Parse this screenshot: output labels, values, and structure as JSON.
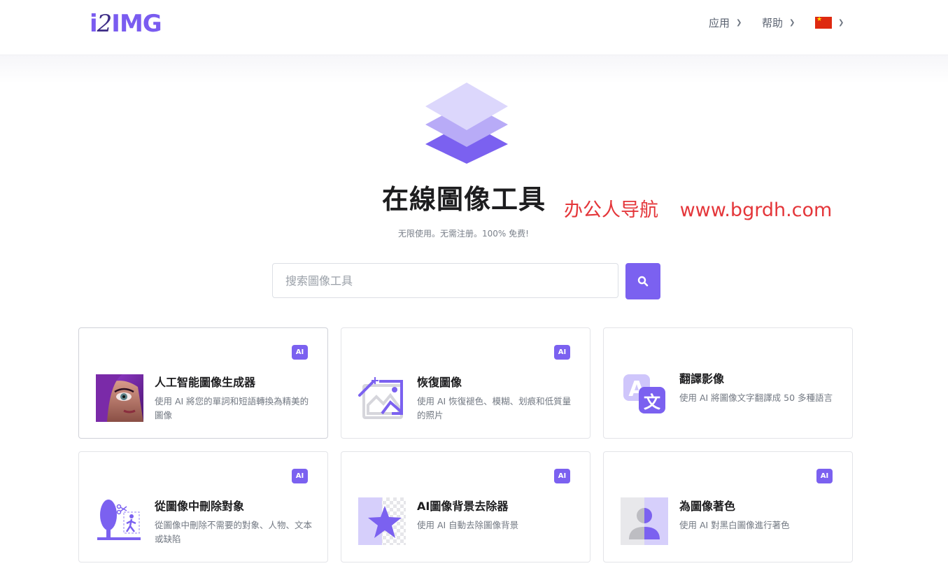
{
  "header": {
    "logo": {
      "prefix": "i",
      "two": "2",
      "suffix": "IMG"
    },
    "nav": {
      "apps": "应用",
      "help": "帮助",
      "language_flag": "china-flag-icon"
    }
  },
  "hero": {
    "title": "在線圖像工具",
    "watermark": "办公人导航 www.bgrdh.com",
    "subtitle": "无限使用。无需注册。100% 免费!"
  },
  "search": {
    "placeholder": "搜索圖像工具",
    "button_icon": "search-icon"
  },
  "tools": [
    {
      "title": "人工智能圖像生成器",
      "desc": "使用 AI 將您的單詞和短語轉換為精美的圖像",
      "badge": "AI",
      "icon": "ai-portrait-image"
    },
    {
      "title": "恢復圖像",
      "desc": "使用 AI 恢復褪色、模糊、划痕和低質量的照片",
      "badge": "AI",
      "icon": "magic-wand-image-icon"
    },
    {
      "title": "翻譯影像",
      "desc": "使用 AI 將圖像文字翻譯成 50 多種語言",
      "badge": "",
      "icon": "translate-icon"
    },
    {
      "title": "從圖像中刪除對象",
      "desc": "從圖像中刪除不需要的對象、人物、文本或缺陷",
      "badge": "AI",
      "icon": "object-remove-icon"
    },
    {
      "title": "AI圖像背景去除器",
      "desc": "使用 AI 自動去除圖像背景",
      "badge": "AI",
      "icon": "background-remove-icon"
    },
    {
      "title": "為圖像著色",
      "desc": "使用 AI 對黑白圖像進行著色",
      "badge": "AI",
      "icon": "colorize-icon"
    }
  ],
  "colors": {
    "accent": "#7b61f0",
    "watermark": "#e4363a"
  }
}
